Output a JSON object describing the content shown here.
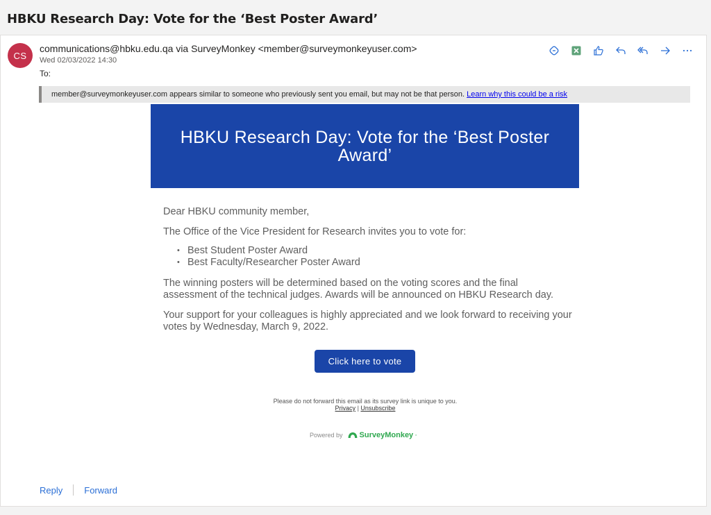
{
  "subject": "HBKU Research Day: Vote for the ‘Best Poster Award’",
  "sender": {
    "initials": "CS",
    "from": "communications@hbku.edu.qa via SurveyMonkey <member@surveymonkeyuser.com>",
    "date": "Wed 02/03/2022 14:30",
    "to": "To:",
    "avatar_color": "#c4314b"
  },
  "toolbar": {
    "icons": [
      "loop-icon",
      "excel-icon",
      "like-icon",
      "reply-icon",
      "reply-all-icon",
      "forward-icon",
      "more-icon"
    ]
  },
  "warning": {
    "text": "member@surveymonkeyuser.com appears similar to someone who previously sent you email, but may not be that person.",
    "link": "Learn why this could be a risk"
  },
  "email": {
    "banner_title": "HBKU Research Day: Vote for the ‘Best Poster Award’",
    "greeting": "Dear HBKU community member,",
    "intro": "The Office of the Vice President for Research invites you to vote for:",
    "awards": [
      "Best Student Poster Award",
      "Best Faculty/Researcher Poster Award"
    ],
    "para1": "The winning posters will be determined based on the voting scores and the final assessment of the technical judges. Awards will be announced on HBKU Research day.",
    "para2": "Your support for your colleagues is highly appreciated and we look forward to receiving your votes by Wednesday, March 9, 2022.",
    "button_label": "Click here to vote",
    "footnote": "Please do not forward this email as its survey link is unique to you.",
    "privacy": "Privacy",
    "separator": "|",
    "unsubscribe": "Unsubscribe",
    "powered_by": "Powered by",
    "brand": "SurveyMonkey",
    "brand_mark": "·"
  },
  "reply_actions": {
    "reply": "Reply",
    "forward": "Forward"
  },
  "colors": {
    "banner": "#1a45a8",
    "accent": "#2b6fd6",
    "brand_green": "#2fa84f"
  }
}
